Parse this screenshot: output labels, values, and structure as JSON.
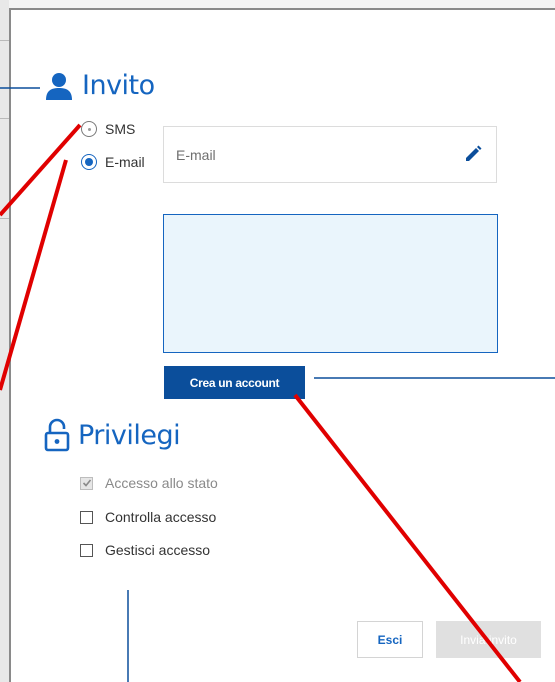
{
  "invite": {
    "title": "Invito",
    "channels": [
      {
        "label": "SMS",
        "selected": false
      },
      {
        "label": "E-mail",
        "selected": true
      }
    ],
    "email_placeholder": "E-mail",
    "create_account_label": "Crea un account"
  },
  "privileges": {
    "title": "Privilegi",
    "items": [
      {
        "label": "Accesso allo stato",
        "checked": true,
        "disabled": true
      },
      {
        "label": "Controlla accesso",
        "checked": false,
        "disabled": false
      },
      {
        "label": "Gestisci accesso",
        "checked": false,
        "disabled": false
      }
    ]
  },
  "footer": {
    "exit_label": "Esci",
    "send_label": "Invia invito"
  },
  "icons": {
    "invite": "person-icon",
    "privileges": "padlock-icon",
    "edit": "pencil-icon"
  },
  "colors": {
    "accent": "#1565c0",
    "primary_button": "#0b4e9b",
    "annotation_red": "#e00000",
    "disabled_button": "#e0e0e0"
  }
}
